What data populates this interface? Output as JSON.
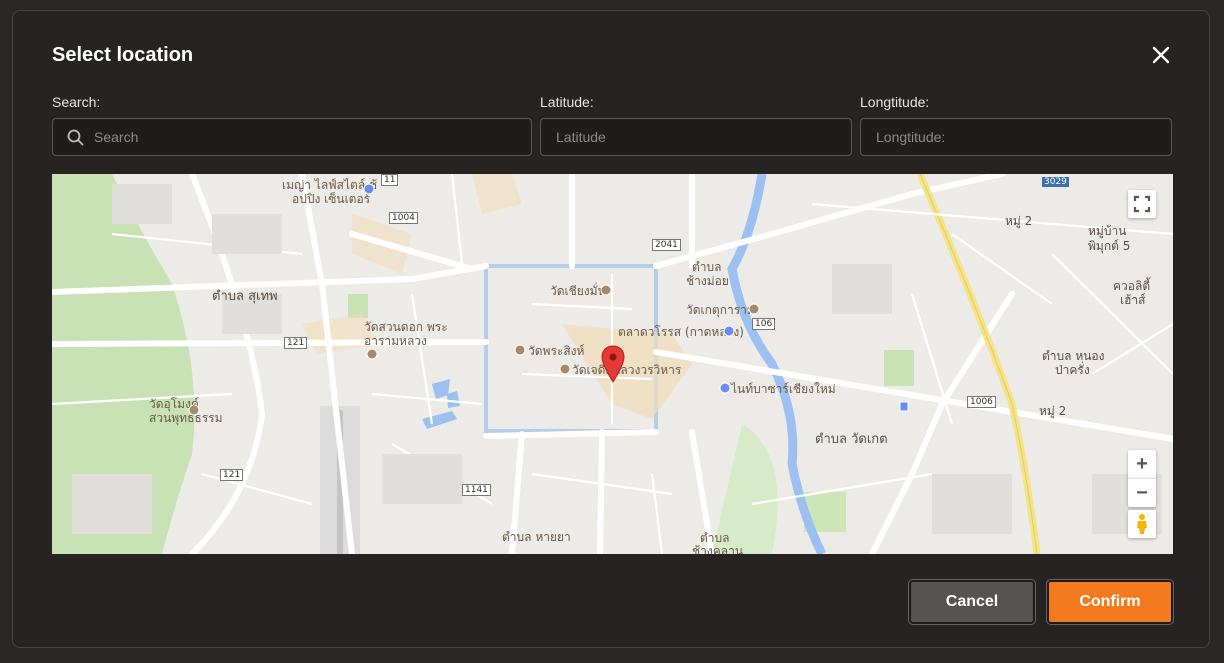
{
  "dialog": {
    "title": "Select location"
  },
  "search": {
    "label": "Search:",
    "placeholder": "Search",
    "value": ""
  },
  "latitude": {
    "label": "Latitude:",
    "placeholder": "Latitude",
    "value": ""
  },
  "longitude": {
    "label": "Longtitude:",
    "placeholder": "Longtitude:",
    "value": ""
  },
  "map": {
    "labels": {
      "mall": "เมญ่า ไลฟ์สไตล์ ช้",
      "mall2": "อปปิง เซ็นเตอร์",
      "suthep": "ตำบล สุเทพ",
      "wat_suan_dok": "วัดสวนดอก พระ",
      "wat_suan_dok2": "อารามหลวง",
      "wat_umong": "วัดอุโมงค์",
      "wat_umong2": "สวนพุทธธรรม",
      "wat_chiang_man": "วัดเชียงมั่น",
      "wat_phra_singh": "วัดพระสิงห์",
      "wat_chedi_luang": "วัดเจดีย์หลวงวรวิหาร",
      "warorot": "ตลาดวโรรส (กาดหลวง)",
      "wat_ket": "วัดเกตุการาม",
      "night_bazaar": "ไนท์บาซาร์เชียงใหม่",
      "chang_moi": "ตำบล",
      "chang_moi2": "ช้างม่อย",
      "wat_ket_sub": "ตำบล วัดเกต",
      "nong_pa_khrang": "ตำบล หนอง",
      "nong_pa_khrang2": "ป่าครั่ง",
      "moo2_a": "หมู่ 2",
      "moo2_b": "หมู่ 2",
      "pimuk": "หมู่บ้าน",
      "pimuk2": "พิมุกต์ 5",
      "kwa": "ควอลิตี้",
      "kwa2": "เฮ้าส์",
      "hai_ya": "ตำบล หายยา",
      "chang_khlan": "ตำบล",
      "chang_khlan2": "ช้างคลาน",
      "road_1004": "1004",
      "road_2041": "2041",
      "road_106": "106",
      "road_121a": "121",
      "road_121b": "121",
      "road_1141": "1141",
      "road_1006": "1006",
      "road_11": "11",
      "road_3029": "3029"
    },
    "controls": {
      "fullscreen": "fullscreen",
      "zoom_in": "+",
      "zoom_out": "−"
    }
  },
  "buttons": {
    "cancel": "Cancel",
    "confirm": "Confirm"
  },
  "colors": {
    "accent": "#f47a20",
    "marker": "#e53935"
  }
}
